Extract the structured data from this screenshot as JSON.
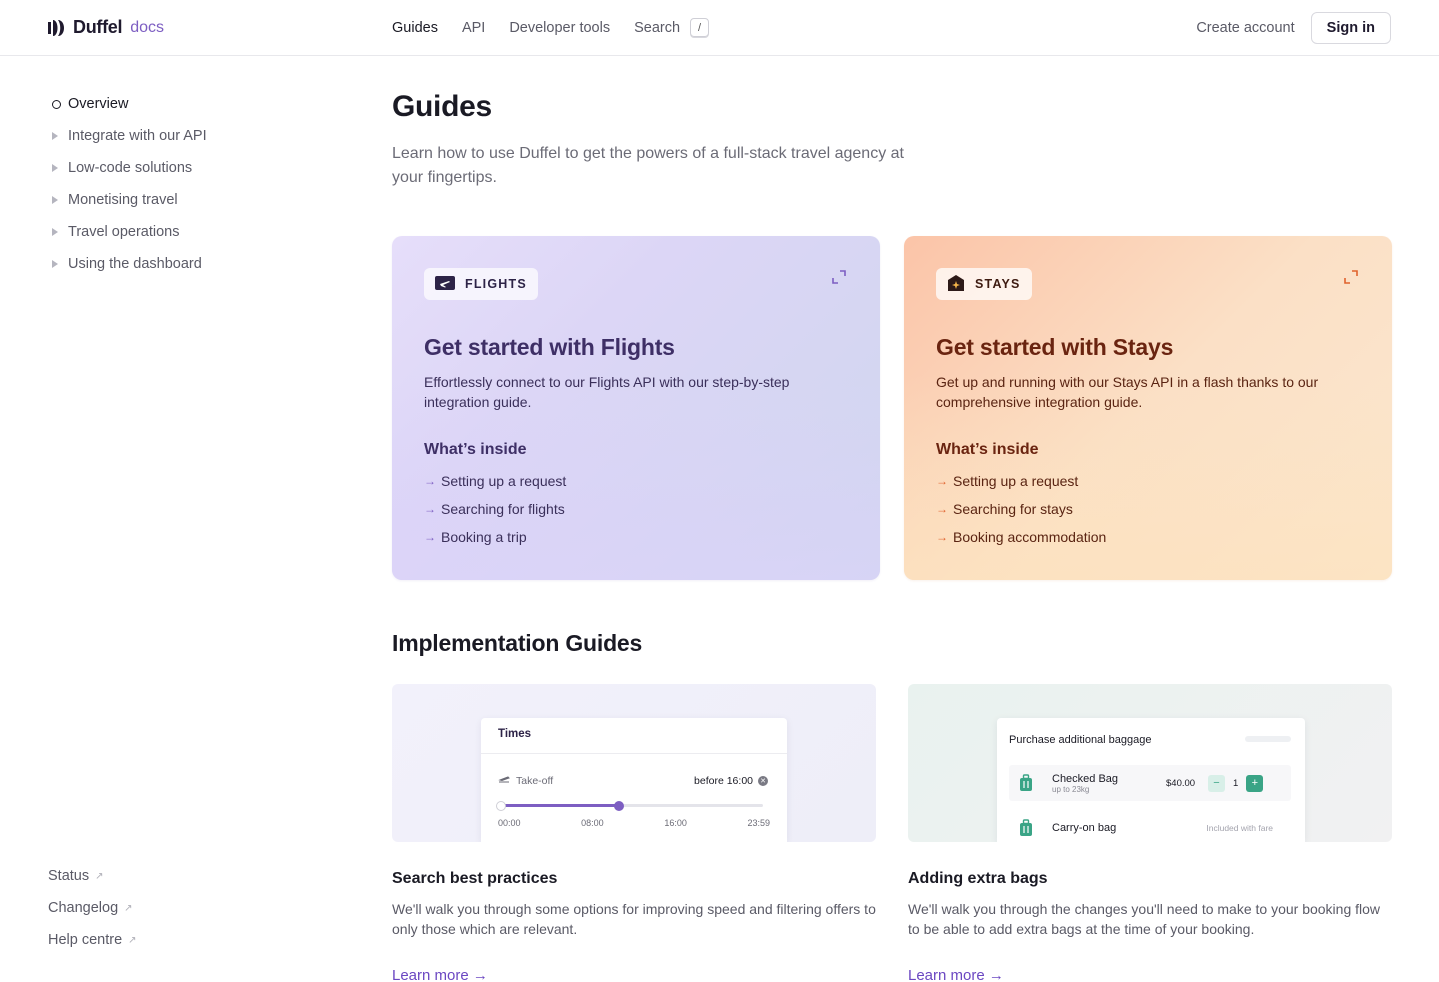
{
  "header": {
    "logo_text": "Duffel",
    "logo_suffix": "docs",
    "nav": [
      {
        "label": "Guides",
        "active": true
      },
      {
        "label": "API",
        "active": false
      },
      {
        "label": "Developer tools",
        "active": false
      }
    ],
    "search_label": "Search",
    "search_shortcut": "/",
    "create_account": "Create account",
    "sign_in": "Sign in"
  },
  "sidebar": {
    "items": [
      {
        "label": "Overview",
        "active": true
      },
      {
        "label": "Integrate with our API",
        "active": false
      },
      {
        "label": "Low-code solutions",
        "active": false
      },
      {
        "label": "Monetising travel",
        "active": false
      },
      {
        "label": "Travel operations",
        "active": false
      },
      {
        "label": "Using the dashboard",
        "active": false
      }
    ],
    "footer_links": [
      {
        "label": "Status",
        "icon": "external-link-icon"
      },
      {
        "label": "Changelog",
        "icon": "external-link-icon"
      },
      {
        "label": "Help centre",
        "icon": "external-link-icon"
      }
    ]
  },
  "main": {
    "title": "Guides",
    "subtitle": "Learn how to use Duffel to get the powers of a full-stack travel agency at your fingertips.",
    "cards": {
      "flights": {
        "badge": "FLIGHTS",
        "title": "Get started with Flights",
        "description": "Effortlessly connect to our Flights API with our step-by-step integration guide.",
        "inside_title": "What’s inside",
        "items": [
          "Setting up a request",
          "Searching for flights",
          "Booking a trip"
        ],
        "accent": "#7d5ec2"
      },
      "stays": {
        "badge": "STAYS",
        "title": "Get started with Stays",
        "description": "Get up and running with our Stays API in a flash thanks to our comprehensive integration guide.",
        "inside_title": "What’s inside",
        "items": [
          "Setting up a request",
          "Searching for stays",
          "Booking accommodation"
        ],
        "accent": "#e0622d"
      }
    },
    "implementation": {
      "title": "Implementation Guides",
      "guides": [
        {
          "title": "Search best practices",
          "description": "We'll walk you through some options for improving speed and filtering offers to only those which are relevant.",
          "link": "Learn more →",
          "preview": {
            "header": "Times",
            "filter_label": "Take-off",
            "filter_value": "before 16:00",
            "ticks": [
              "00:00",
              "08:00",
              "16:00",
              "23:59"
            ],
            "range_fraction": 0.45
          }
        },
        {
          "title": "Adding extra bags",
          "description": "We'll walk you through the changes you'll need to make to your booking flow to be able to add extra bags at the time of your booking.",
          "link": "Learn more →",
          "preview": {
            "header": "Purchase additional baggage",
            "bags": [
              {
                "name": "Checked Bag",
                "sub": "up to 23kg",
                "price": "$40.00",
                "qty": "1"
              },
              {
                "name": "Carry-on bag",
                "note": "Included with fare"
              }
            ]
          }
        }
      ]
    }
  }
}
